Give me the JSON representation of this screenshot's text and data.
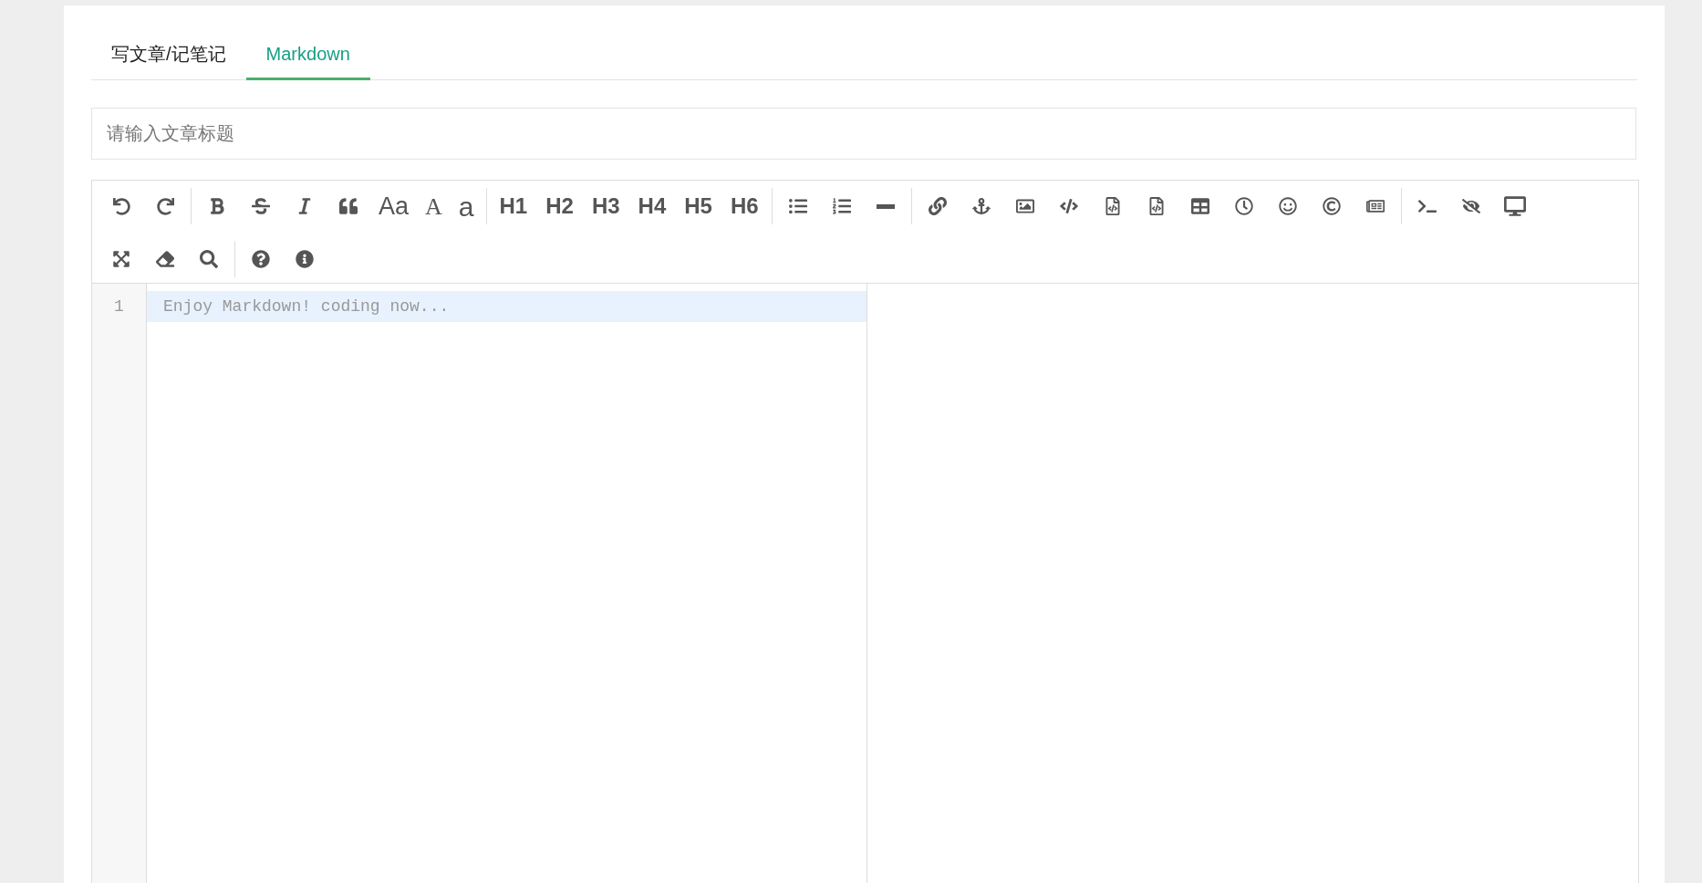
{
  "tabs": [
    {
      "label": "写文章/记笔记",
      "selected": false
    },
    {
      "label": "Markdown",
      "selected": true
    }
  ],
  "title_field": {
    "placeholder": "请输入文章标题"
  },
  "toolbar": {
    "case_buttons": [
      "Aa",
      "A",
      "a"
    ],
    "heading_buttons": [
      "H1",
      "H2",
      "H3",
      "H4",
      "H5",
      "H6"
    ]
  },
  "editor": {
    "line_numbers": [
      "1"
    ],
    "placeholder": "Enjoy Markdown! coding now..."
  }
}
